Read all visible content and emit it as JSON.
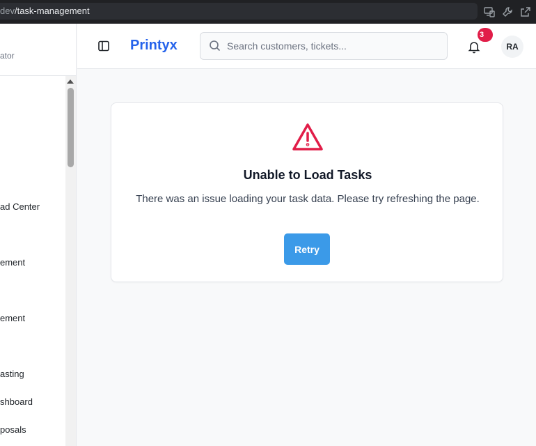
{
  "browser": {
    "url_host_fragment": "dev",
    "url_path": "/task-management",
    "icons": [
      "devices-icon",
      "wrench-icon",
      "open-external-icon"
    ]
  },
  "sidebar": {
    "role_text": "ator",
    "items": [
      {
        "label": "ad Center"
      },
      {
        "label": "ement"
      },
      {
        "label": "ement"
      },
      {
        "label": "asting"
      },
      {
        "label": "shboard"
      },
      {
        "label": "posals"
      }
    ]
  },
  "header": {
    "brand": "Printyx",
    "search_placeholder": "Search customers, tickets...",
    "notification_count": "3",
    "avatar_initials": "RA"
  },
  "error_card": {
    "title": "Unable to Load Tasks",
    "message": "There was an issue loading your task data. Please try refreshing the page.",
    "retry_label": "Retry"
  },
  "colors": {
    "brand": "#2563eb",
    "danger": "#e11d48",
    "retry_button": "#3b9ae8"
  }
}
